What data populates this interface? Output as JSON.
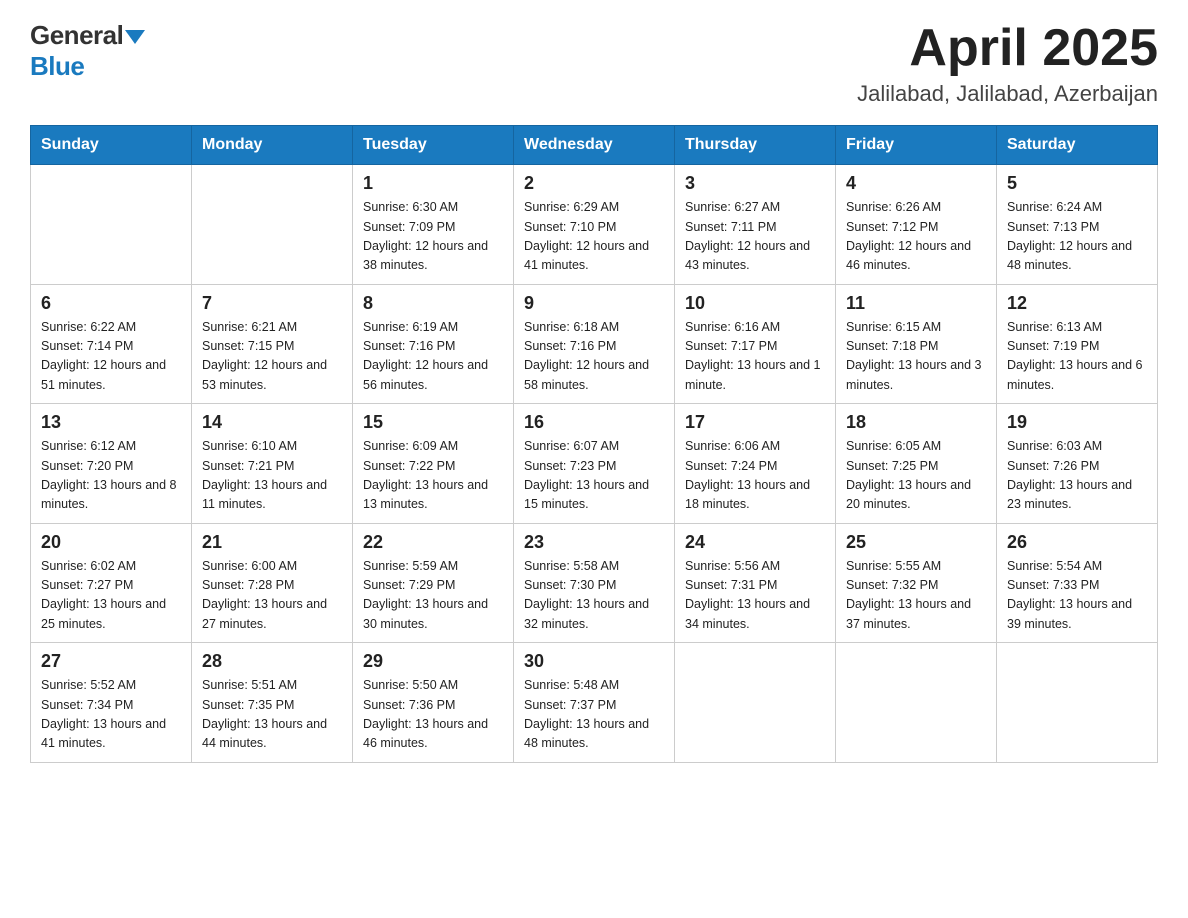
{
  "header": {
    "logo_general": "General",
    "logo_blue": "Blue",
    "title": "April 2025",
    "subtitle": "Jalilabad, Jalilabad, Azerbaijan"
  },
  "days_of_week": [
    "Sunday",
    "Monday",
    "Tuesday",
    "Wednesday",
    "Thursday",
    "Friday",
    "Saturday"
  ],
  "weeks": [
    [
      {
        "day": "",
        "sunrise": "",
        "sunset": "",
        "daylight": ""
      },
      {
        "day": "",
        "sunrise": "",
        "sunset": "",
        "daylight": ""
      },
      {
        "day": "1",
        "sunrise": "Sunrise: 6:30 AM",
        "sunset": "Sunset: 7:09 PM",
        "daylight": "Daylight: 12 hours and 38 minutes."
      },
      {
        "day": "2",
        "sunrise": "Sunrise: 6:29 AM",
        "sunset": "Sunset: 7:10 PM",
        "daylight": "Daylight: 12 hours and 41 minutes."
      },
      {
        "day": "3",
        "sunrise": "Sunrise: 6:27 AM",
        "sunset": "Sunset: 7:11 PM",
        "daylight": "Daylight: 12 hours and 43 minutes."
      },
      {
        "day": "4",
        "sunrise": "Sunrise: 6:26 AM",
        "sunset": "Sunset: 7:12 PM",
        "daylight": "Daylight: 12 hours and 46 minutes."
      },
      {
        "day": "5",
        "sunrise": "Sunrise: 6:24 AM",
        "sunset": "Sunset: 7:13 PM",
        "daylight": "Daylight: 12 hours and 48 minutes."
      }
    ],
    [
      {
        "day": "6",
        "sunrise": "Sunrise: 6:22 AM",
        "sunset": "Sunset: 7:14 PM",
        "daylight": "Daylight: 12 hours and 51 minutes."
      },
      {
        "day": "7",
        "sunrise": "Sunrise: 6:21 AM",
        "sunset": "Sunset: 7:15 PM",
        "daylight": "Daylight: 12 hours and 53 minutes."
      },
      {
        "day": "8",
        "sunrise": "Sunrise: 6:19 AM",
        "sunset": "Sunset: 7:16 PM",
        "daylight": "Daylight: 12 hours and 56 minutes."
      },
      {
        "day": "9",
        "sunrise": "Sunrise: 6:18 AM",
        "sunset": "Sunset: 7:16 PM",
        "daylight": "Daylight: 12 hours and 58 minutes."
      },
      {
        "day": "10",
        "sunrise": "Sunrise: 6:16 AM",
        "sunset": "Sunset: 7:17 PM",
        "daylight": "Daylight: 13 hours and 1 minute."
      },
      {
        "day": "11",
        "sunrise": "Sunrise: 6:15 AM",
        "sunset": "Sunset: 7:18 PM",
        "daylight": "Daylight: 13 hours and 3 minutes."
      },
      {
        "day": "12",
        "sunrise": "Sunrise: 6:13 AM",
        "sunset": "Sunset: 7:19 PM",
        "daylight": "Daylight: 13 hours and 6 minutes."
      }
    ],
    [
      {
        "day": "13",
        "sunrise": "Sunrise: 6:12 AM",
        "sunset": "Sunset: 7:20 PM",
        "daylight": "Daylight: 13 hours and 8 minutes."
      },
      {
        "day": "14",
        "sunrise": "Sunrise: 6:10 AM",
        "sunset": "Sunset: 7:21 PM",
        "daylight": "Daylight: 13 hours and 11 minutes."
      },
      {
        "day": "15",
        "sunrise": "Sunrise: 6:09 AM",
        "sunset": "Sunset: 7:22 PM",
        "daylight": "Daylight: 13 hours and 13 minutes."
      },
      {
        "day": "16",
        "sunrise": "Sunrise: 6:07 AM",
        "sunset": "Sunset: 7:23 PM",
        "daylight": "Daylight: 13 hours and 15 minutes."
      },
      {
        "day": "17",
        "sunrise": "Sunrise: 6:06 AM",
        "sunset": "Sunset: 7:24 PM",
        "daylight": "Daylight: 13 hours and 18 minutes."
      },
      {
        "day": "18",
        "sunrise": "Sunrise: 6:05 AM",
        "sunset": "Sunset: 7:25 PM",
        "daylight": "Daylight: 13 hours and 20 minutes."
      },
      {
        "day": "19",
        "sunrise": "Sunrise: 6:03 AM",
        "sunset": "Sunset: 7:26 PM",
        "daylight": "Daylight: 13 hours and 23 minutes."
      }
    ],
    [
      {
        "day": "20",
        "sunrise": "Sunrise: 6:02 AM",
        "sunset": "Sunset: 7:27 PM",
        "daylight": "Daylight: 13 hours and 25 minutes."
      },
      {
        "day": "21",
        "sunrise": "Sunrise: 6:00 AM",
        "sunset": "Sunset: 7:28 PM",
        "daylight": "Daylight: 13 hours and 27 minutes."
      },
      {
        "day": "22",
        "sunrise": "Sunrise: 5:59 AM",
        "sunset": "Sunset: 7:29 PM",
        "daylight": "Daylight: 13 hours and 30 minutes."
      },
      {
        "day": "23",
        "sunrise": "Sunrise: 5:58 AM",
        "sunset": "Sunset: 7:30 PM",
        "daylight": "Daylight: 13 hours and 32 minutes."
      },
      {
        "day": "24",
        "sunrise": "Sunrise: 5:56 AM",
        "sunset": "Sunset: 7:31 PM",
        "daylight": "Daylight: 13 hours and 34 minutes."
      },
      {
        "day": "25",
        "sunrise": "Sunrise: 5:55 AM",
        "sunset": "Sunset: 7:32 PM",
        "daylight": "Daylight: 13 hours and 37 minutes."
      },
      {
        "day": "26",
        "sunrise": "Sunrise: 5:54 AM",
        "sunset": "Sunset: 7:33 PM",
        "daylight": "Daylight: 13 hours and 39 minutes."
      }
    ],
    [
      {
        "day": "27",
        "sunrise": "Sunrise: 5:52 AM",
        "sunset": "Sunset: 7:34 PM",
        "daylight": "Daylight: 13 hours and 41 minutes."
      },
      {
        "day": "28",
        "sunrise": "Sunrise: 5:51 AM",
        "sunset": "Sunset: 7:35 PM",
        "daylight": "Daylight: 13 hours and 44 minutes."
      },
      {
        "day": "29",
        "sunrise": "Sunrise: 5:50 AM",
        "sunset": "Sunset: 7:36 PM",
        "daylight": "Daylight: 13 hours and 46 minutes."
      },
      {
        "day": "30",
        "sunrise": "Sunrise: 5:48 AM",
        "sunset": "Sunset: 7:37 PM",
        "daylight": "Daylight: 13 hours and 48 minutes."
      },
      {
        "day": "",
        "sunrise": "",
        "sunset": "",
        "daylight": ""
      },
      {
        "day": "",
        "sunrise": "",
        "sunset": "",
        "daylight": ""
      },
      {
        "day": "",
        "sunrise": "",
        "sunset": "",
        "daylight": ""
      }
    ]
  ]
}
